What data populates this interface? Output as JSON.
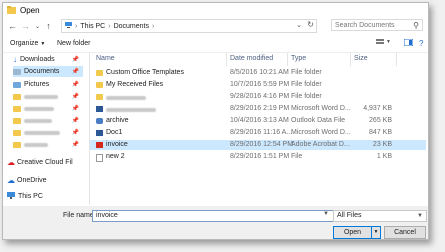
{
  "window": {
    "title": "Open"
  },
  "address": {
    "crumbs": [
      "This PC",
      "Documents"
    ],
    "search_placeholder": "Search Documents"
  },
  "toolbar": {
    "organize_label": "Organize",
    "new_folder_label": "New folder"
  },
  "sidebar": {
    "items": [
      {
        "label": "Downloads",
        "icon": "download-icon",
        "pinned": true
      },
      {
        "label": "Documents",
        "icon": "documents-icon",
        "pinned": true,
        "selected": true
      },
      {
        "label": "Pictures",
        "icon": "pictures-icon",
        "pinned": true
      },
      {
        "label": "",
        "icon": "folder-icon",
        "pinned": true,
        "obscured": true
      },
      {
        "label": "",
        "icon": "folder-icon",
        "pinned": true,
        "obscured": true
      },
      {
        "label": "",
        "icon": "folder-icon",
        "pinned": true,
        "obscured": true
      },
      {
        "label": "",
        "icon": "folder-icon",
        "pinned": true,
        "obscured": true
      },
      {
        "label": "",
        "icon": "folder-icon",
        "pinned": true,
        "obscured": true
      },
      {
        "label": "Creative Cloud Fil",
        "icon": "creative-cloud-icon"
      },
      {
        "label": "OneDrive",
        "icon": "onedrive-icon"
      },
      {
        "label": "This PC",
        "icon": "this-pc-icon"
      }
    ]
  },
  "filelist": {
    "columns": [
      "Name",
      "Date modified",
      "Type",
      "Size"
    ],
    "rows": [
      {
        "name": "Custom Office Templates",
        "date": "8/5/2016 10:21 AM",
        "type": "File folder",
        "size": "",
        "icon": "folder-icon"
      },
      {
        "name": "My Received Files",
        "date": "10/7/2016 5:59 PM",
        "type": "File folder",
        "size": "",
        "icon": "folder-icon"
      },
      {
        "name": "",
        "date": "9/28/2016 4:16 PM",
        "type": "File folder",
        "size": "",
        "icon": "folder-icon",
        "obscured": true
      },
      {
        "name": "",
        "date": "8/29/2016 2:19 PM",
        "type": "Microsoft Word D...",
        "size": "4,937 KB",
        "icon": "word-doc-icon",
        "obscured": true
      },
      {
        "name": "archive",
        "date": "10/4/2016 3:13 AM",
        "type": "Outlook Data File",
        "size": "265 KB",
        "icon": "outlook-data-icon"
      },
      {
        "name": "Doc1",
        "date": "8/29/2016 11:16 A...",
        "type": "Microsoft Word D...",
        "size": "847 KB",
        "icon": "word-doc-icon"
      },
      {
        "name": "invoice",
        "date": "8/29/2016 12:54 PM",
        "type": "Adobe Acrobat D...",
        "size": "23 KB",
        "icon": "pdf-icon",
        "selected": true
      },
      {
        "name": "new 2",
        "date": "8/29/2016 1:51 PM",
        "type": "File",
        "size": "1 KB",
        "icon": "file-icon"
      }
    ]
  },
  "bottom": {
    "file_name_label": "File name:",
    "file_name_value": "invoice",
    "file_type_value": "All Files",
    "open_label": "Open",
    "cancel_label": "Cancel"
  },
  "colors": {
    "selection": "#cce8ff",
    "accent": "#0078d7",
    "folder": "#f2c94c"
  }
}
